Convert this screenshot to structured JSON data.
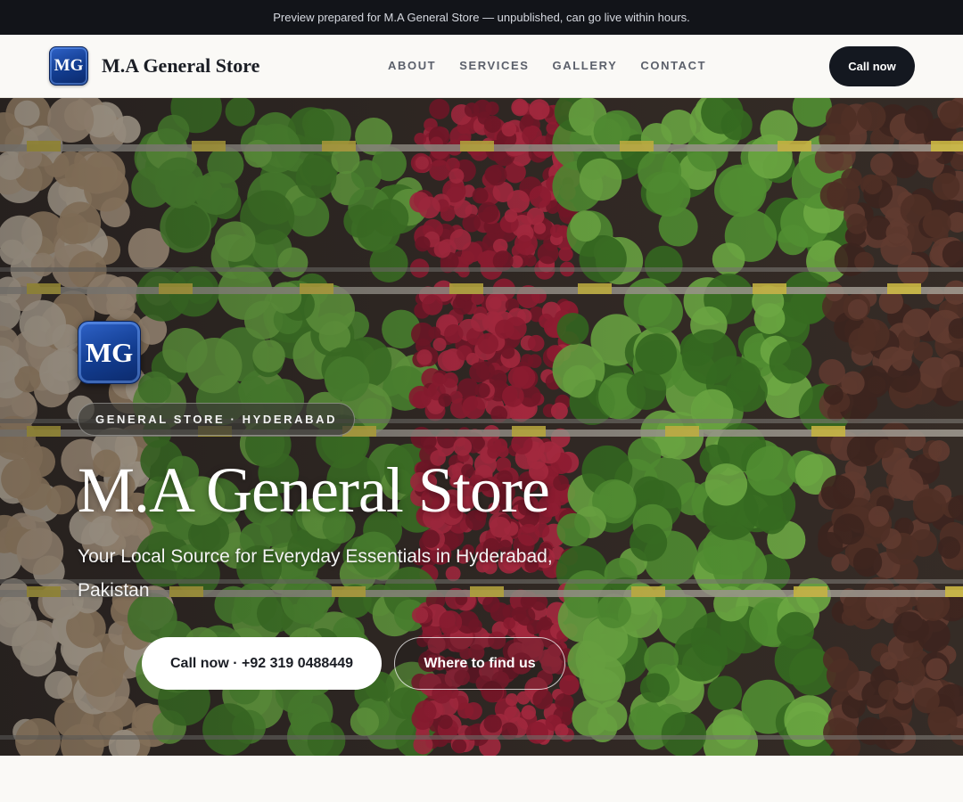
{
  "preview_bar": {
    "text": "Preview prepared for M.A General Store — unpublished, can go live within hours."
  },
  "header": {
    "logo_text": "MG",
    "brand_name": "M.A General Store",
    "nav": [
      {
        "label": "ABOUT"
      },
      {
        "label": "SERVICES"
      },
      {
        "label": "GALLERY"
      },
      {
        "label": "CONTACT"
      }
    ],
    "call_button": "Call now"
  },
  "hero": {
    "logo_text": "MG",
    "tag": "GENERAL STORE · HYDERABAD",
    "title": "M.A General Store",
    "subtitle": "Your Local Source for Everyday Essentials in Hyderabad, Pakistan",
    "primary_button": "Call now · +92 319 0488449",
    "secondary_button": "Where to find us",
    "background_image": "produce-shelves-photo"
  },
  "colors": {
    "preview_bar_bg": "#121419",
    "header_bg": "#faf9f6",
    "dark_button": "#141820",
    "logo_blue": "#123c8f",
    "page_bg": "#faf9f6"
  }
}
